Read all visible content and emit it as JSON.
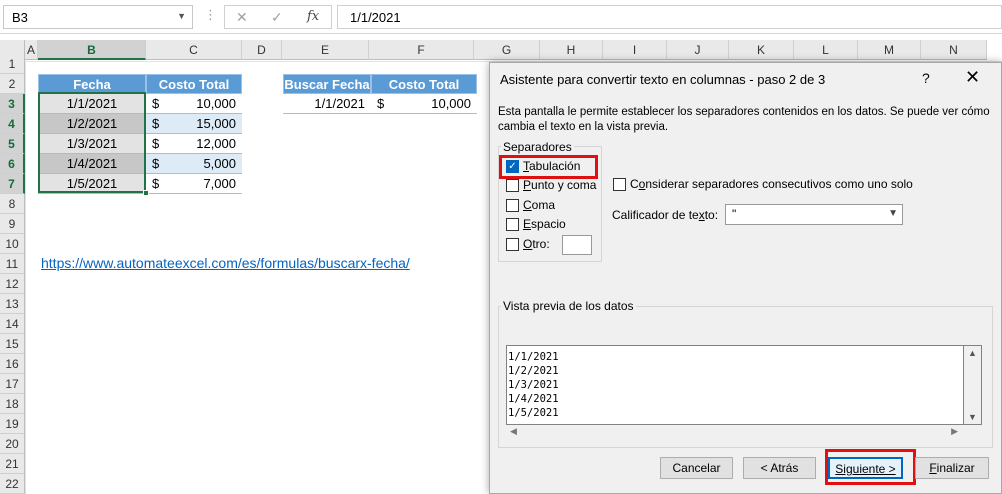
{
  "formula_bar": {
    "name_box": "B3",
    "cancel_icon": "✕",
    "enter_icon": "✓",
    "fx_label": "fx",
    "formula": "1/1/2021"
  },
  "columns": [
    "A",
    "B",
    "C",
    "D",
    "E",
    "F",
    "G",
    "H",
    "I",
    "J",
    "K",
    "L",
    "M",
    "N"
  ],
  "rows": [
    "1",
    "2",
    "3",
    "4",
    "5",
    "6",
    "7",
    "8",
    "9",
    "10",
    "11",
    "12",
    "13",
    "14",
    "15",
    "16",
    "17",
    "18",
    "19",
    "20",
    "21",
    "22"
  ],
  "table1": {
    "headers": [
      "Fecha",
      "Costo Total"
    ],
    "rows": [
      {
        "date": "1/1/2021",
        "currency": "$",
        "amount": "10,000"
      },
      {
        "date": "1/2/2021",
        "currency": "$",
        "amount": "15,000"
      },
      {
        "date": "1/3/2021",
        "currency": "$",
        "amount": "12,000"
      },
      {
        "date": "1/4/2021",
        "currency": "$",
        "amount": "5,000"
      },
      {
        "date": "1/5/2021",
        "currency": "$",
        "amount": "7,000"
      }
    ]
  },
  "table2": {
    "headers": [
      "Buscar Fecha",
      "Costo Total"
    ],
    "row": {
      "date": "1/1/2021",
      "currency": "$",
      "amount": "10,000"
    }
  },
  "link": "https://www.automateexcel.com/es/formulas/buscarx-fecha/",
  "dialog": {
    "title": "Asistente para convertir texto en columnas - paso 2 de 3",
    "help": "?",
    "close": "✕",
    "description": "Esta pantalla le permite establecer los separadores contenidos en los datos. Se puede ver cómo cambia el texto en la vista previa.",
    "separators_label": "Separadores",
    "separators": {
      "tab": {
        "first": "T",
        "rest": "abulación",
        "checked": true
      },
      "semicolon": {
        "first": "P",
        "rest": "unto y coma",
        "checked": false
      },
      "comma": {
        "first": "C",
        "rest": "oma",
        "checked": false
      },
      "space": {
        "first": "E",
        "rest": "spacio",
        "checked": false
      },
      "other": {
        "first": "O",
        "rest": "tro:",
        "checked": false
      }
    },
    "consecutive": {
      "pre": "C",
      "u": "o",
      "rest": "nsiderar separadores consecutivos como uno solo"
    },
    "qualifier": {
      "pre": "Calificador de te",
      "u": "x",
      "rest": "to:",
      "value": "\""
    },
    "preview_label": "Vista previa de los datos",
    "preview_lines": [
      "1/1/2021",
      "1/2/2021",
      "1/3/2021",
      "1/4/2021",
      "1/5/2021"
    ],
    "buttons": {
      "cancel": "Cancelar",
      "back": "< Atrás",
      "next": "Siguiente >",
      "finish": "Finalizar"
    }
  }
}
